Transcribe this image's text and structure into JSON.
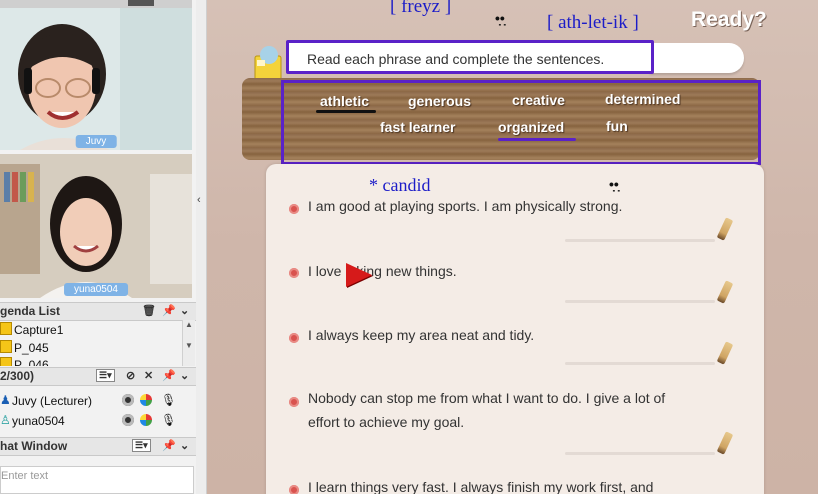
{
  "left_panel": {
    "camera1_name": "Juvy",
    "camera2_name": "yuna0504",
    "agenda": {
      "title": "genda List",
      "items": [
        "Capture1",
        "P_045",
        "P_046"
      ]
    },
    "users": {
      "count_label": "2/300)",
      "list": [
        "Juvy (Lecturer)",
        "yuna0504"
      ]
    },
    "chat": {
      "title": "hat Window",
      "placeholder": "Enter text"
    }
  },
  "main": {
    "annotations": {
      "freyz": "[ freyz ]",
      "athletik": "[ ath-let-ik ]",
      "candid": "* candid"
    },
    "ready": "Ready?",
    "instruction": "Read each phrase and complete the sentences.",
    "word_bank": {
      "row1": [
        "athletic",
        "generous",
        "creative",
        "determined"
      ],
      "row2": [
        "fast learner",
        "organized",
        "fun"
      ],
      "underline_colors": {
        "athletic": "#111111",
        "organized": "#5a22c8"
      }
    },
    "questions": [
      "I am good at playing sports. I am physically strong.",
      "I love ʼaking new things.",
      "I always keep my area neat and tidy.",
      "Nobody can stop me from what I want to do. I give a lot of",
      "effort to achieve my goal.",
      "I learn things very fast. I always finish my work first, and"
    ],
    "accent_color": "#5a22c8",
    "annotation_color": "#1c1cc8"
  }
}
